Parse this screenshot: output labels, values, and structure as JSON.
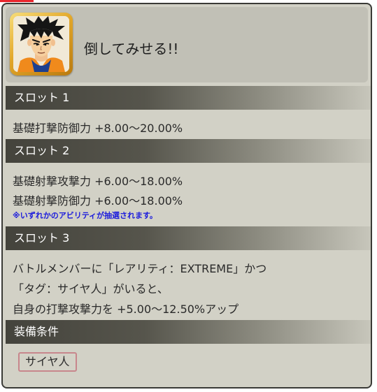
{
  "header": {
    "title": "倒してみせる!!",
    "portrait": "goku-character-portrait"
  },
  "slots": [
    {
      "label": "スロット 1",
      "lines": [
        "基礎打撃防御力 +8.00〜20.00%"
      ]
    },
    {
      "label": "スロット 2",
      "lines": [
        "基礎射撃攻撃力 +6.00〜18.00%",
        "基礎射撃防御力 +6.00〜18.00%"
      ],
      "note": "※いずれかのアビリティが抽選されます。"
    },
    {
      "label": "スロット 3",
      "lines": [
        "バトルメンバーに「レアリティ：EXTREME」かつ",
        "「タグ：サイヤ人」がいると、",
        "自身の打撃攻撃力を +5.00〜12.50%アップ"
      ]
    }
  ],
  "equip": {
    "label": "装備条件",
    "tag": "サイヤ人"
  },
  "colors": {
    "panel": "#d2d1c6",
    "header_box": "#c1c0b6",
    "bar_dark": "#44433c",
    "note_blue": "#1a1adc",
    "tag_border": "#c8868c",
    "accent_red": "#e8262c"
  }
}
